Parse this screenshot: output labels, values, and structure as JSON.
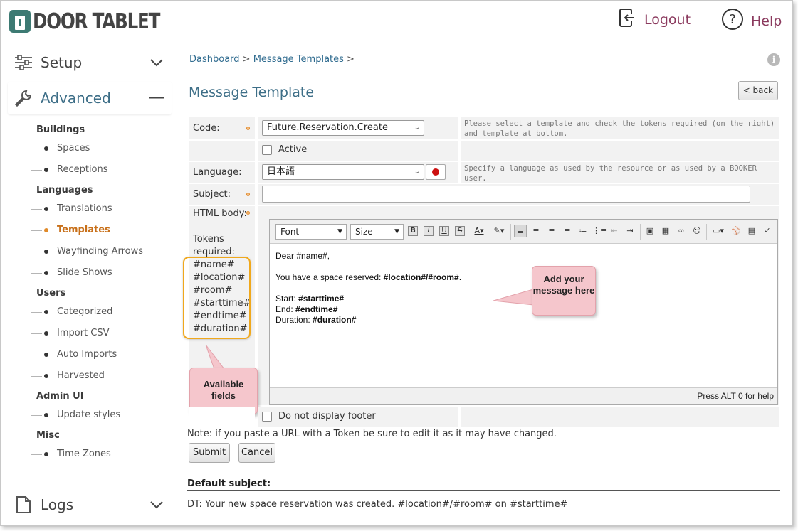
{
  "app": {
    "brand": "DOOR TABLET"
  },
  "header": {
    "logout_label": "Logout",
    "help_label": "Help"
  },
  "sidebar": {
    "setup_label": "Setup",
    "advanced_label": "Advanced",
    "logs_label": "Logs",
    "groups": [
      {
        "title": "Buildings",
        "items": [
          "Spaces",
          "Receptions"
        ]
      },
      {
        "title": "Languages",
        "items": [
          "Translations",
          "Templates",
          "Wayfinding Arrows",
          "Slide Shows"
        ]
      },
      {
        "title": "Users",
        "items": [
          "Categorized",
          "Import CSV",
          "Auto Imports",
          "Harvested"
        ]
      },
      {
        "title": "Admin UI",
        "items": [
          "Update styles"
        ]
      },
      {
        "title": "Misc",
        "items": [
          "Time Zones"
        ]
      }
    ],
    "current_item": "Templates"
  },
  "breadcrumb": {
    "dashboard": "Dashboard",
    "sep1": " > ",
    "templates": "Message Templates",
    "sep2": " >"
  },
  "page": {
    "title": "Message Template",
    "back_label": "< back",
    "info_glyph": "i"
  },
  "form": {
    "code_label": "Code:",
    "code_value": "Future.Reservation.Create",
    "code_help": "Please select a template and check the tokens required (on the right) and template at bottom.",
    "active_label": "Active",
    "language_label": "Language:",
    "language_value": "日本語",
    "language_help": "Specify a language as used by the resource or as used by a BOOKER user.",
    "subject_label": "Subject:",
    "subject_value": "",
    "html_body_label": "HTML body:",
    "tokens_label": "Tokens required:",
    "tokens": [
      "#name#",
      "#location#",
      "#room#",
      "#starttime#",
      "#endtime#",
      "#duration#"
    ],
    "no_footer_label": "Do not display footer",
    "note": "Note: if you paste a URL with a Token be sure to edit it as it may have changed.",
    "submit_label": "Submit",
    "cancel_label": "Cancel"
  },
  "editor": {
    "font_label": "Font",
    "size_label": "Size",
    "body": {
      "greeting": "Dear #name#,",
      "line1_prefix": "You have a space reserved: ",
      "line1_tokens": "#location#/#room#",
      "line1_suffix": ".",
      "start_label": "Start: ",
      "start_token": "#starttime#",
      "end_label": "End: ",
      "end_token": "#endtime#",
      "duration_label": "Duration: ",
      "duration_token": "#duration#"
    },
    "footer_hint": "Press ALT 0 for help"
  },
  "callouts": {
    "message": "Add your message here",
    "fields": "Available fields"
  },
  "defaults": {
    "subject_heading": "Default subject:",
    "subject_text": "DT: Your new space reservation was created. #location#/#room# on #starttime#"
  },
  "colors": {
    "accent": "#3d6e87",
    "logout_help": "#8b3a5e",
    "highlight": "#e08a2a",
    "callout": "#f5c6cc",
    "token_box": "#f0a81c"
  }
}
